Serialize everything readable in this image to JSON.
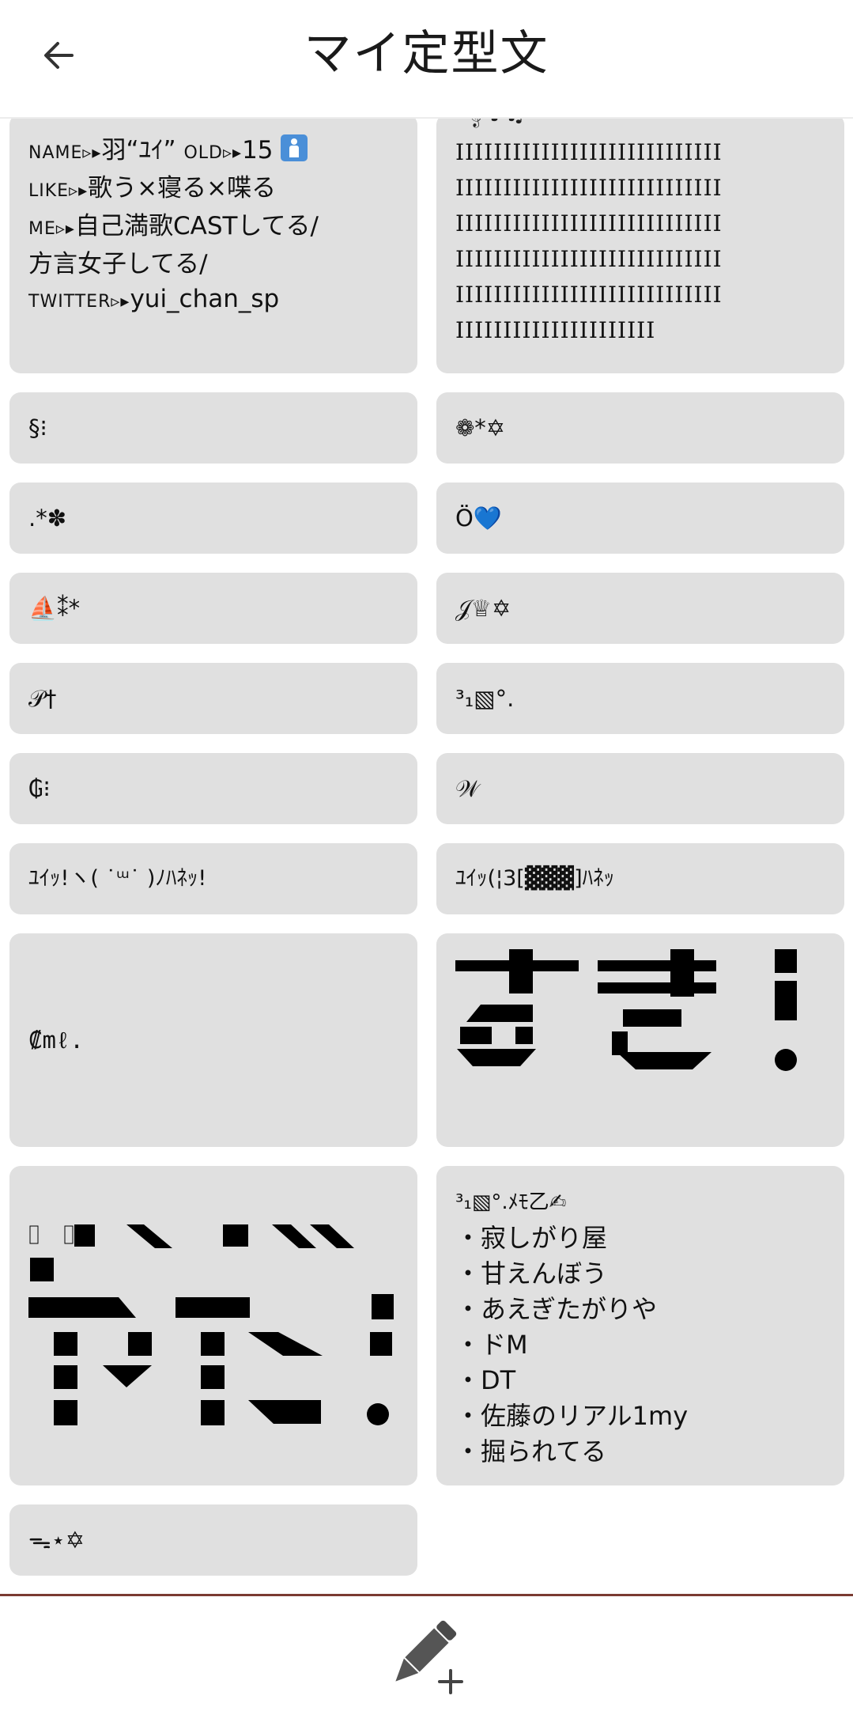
{
  "header": {
    "title": "マイ定型文",
    "back_icon": "arrow-left-icon"
  },
  "cards": {
    "profile": {
      "name_label": "NAME",
      "name_value": "羽“ﾕｲ”",
      "old_label": "OLD",
      "old_value": "15",
      "like_label": "LIKE",
      "like_value": "歌う×寝る×喋る",
      "me_label": "ME",
      "me_value": "自己満歌CASTしてる/",
      "me_value2": "方言女子してる/",
      "twitter_label": "TWITTER",
      "twitter_value": "yui_chan_sp",
      "arrow": "▹▸"
    },
    "ibars": "IIIIIIIIIIIIIIIIIIIIIIIIIIII\nIIIIIIIIIIIIIIIIIIIIIIIIIIII\nIIIIIIIIIIIIIIIIIIIIIIIIIIII\nIIIIIIIIIIIIIIIIIIIIIIIIIIII\nIIIIIIIIIIIIIIIIIIIIIIIIIIII\nIIIIIIIIIIIIIIIIIIIII",
    "r2_left": "§⁝",
    "r2_right": "❁*✡",
    "r3_left": ".*✽",
    "r3_right": "Ö💙",
    "r4_left": "⛵⁑*",
    "r4_right": "𝒥♕✡",
    "r5_left": "𝒫†",
    "r5_right": "³₁▧°.",
    "r6_left": "₲⁝",
    "r6_right": "𝒲",
    "r7_left": "ﾕｲｯ!ヽ( ˙ᵚ˙ )ﾉﾊﾈｯ!",
    "r7_right": "ﾕｲｯ(¦3[▓▓▓]ﾊﾈｯ",
    "r8_left": "₡mℓ.",
    "memo_header": "³₁▧°.ﾒﾓ乙✍",
    "memo_lines": [
      "・寂しがり屋",
      "・甘えんぼう",
      "・あえぎたがりや",
      "・ドM",
      "・DT",
      "・佐藤のリアル1my",
      "・掘られてる"
    ],
    "r10_left": "ᯓ⋆✡"
  },
  "footer": {
    "add_icon": "pencil-add-icon"
  }
}
